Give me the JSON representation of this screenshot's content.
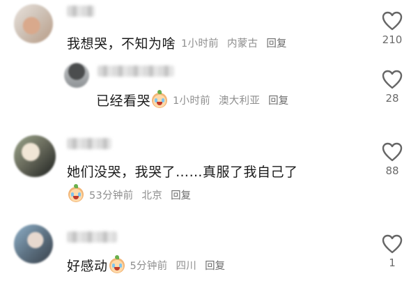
{
  "comments": [
    {
      "text": "我想哭，不知为啥",
      "time": "1小时前",
      "location": "内蒙古",
      "reply_label": "回复",
      "likes": "210",
      "emoji": null
    },
    {
      "text": "已经看哭",
      "time": "1小时前",
      "location": "澳大利亚",
      "reply_label": "回复",
      "likes": "28",
      "emoji": "crying-face"
    },
    {
      "text": "她们没哭，我哭了……真服了我自己了",
      "time": "53分钟前",
      "location": "北京",
      "reply_label": "回复",
      "likes": "88",
      "emoji": "crying-face"
    },
    {
      "text": "好感动",
      "time": "5分钟前",
      "location": "四川",
      "reply_label": "回复",
      "likes": "1",
      "emoji": "crying-face"
    }
  ],
  "icons": {
    "like": "heart-outline-icon",
    "avatar": "blurred-avatar",
    "emoji": "crying-face-emoji"
  },
  "colors": {
    "text": "#1a1a1a",
    "meta": "#8e8e8e",
    "icon": "#666666"
  }
}
